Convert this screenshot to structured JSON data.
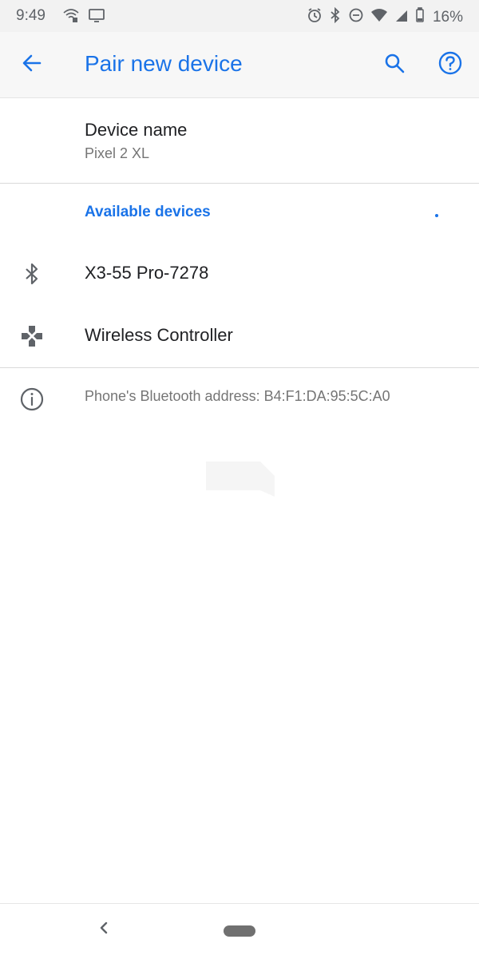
{
  "status_bar": {
    "time": "9:49",
    "battery": "16%",
    "icons": [
      "wifi-calling-icon",
      "cast-icon",
      "alarm-icon",
      "bluetooth-icon",
      "do-not-disturb-icon",
      "wifi-icon",
      "cell-signal-icon",
      "battery-icon"
    ]
  },
  "app_bar": {
    "title": "Pair new device",
    "back_icon": "arrow-back-icon",
    "search_icon": "search-icon",
    "help_icon": "help-icon"
  },
  "device_name": {
    "title": "Device name",
    "value": "Pixel 2 XL"
  },
  "available_devices": {
    "header": "Available devices",
    "items": [
      {
        "label": "X3-55 Pro-7278",
        "icon": "bluetooth-icon"
      },
      {
        "label": "Wireless Controller",
        "icon": "gamepad-icon"
      }
    ]
  },
  "info": {
    "text": "Phone's Bluetooth address: B4:F1:DA:95:5C:A0",
    "icon": "info-icon"
  },
  "colors": {
    "accent": "#1a73e8",
    "primary_text": "#202124",
    "secondary_text": "#757575",
    "icon_gray": "#5f6368"
  }
}
